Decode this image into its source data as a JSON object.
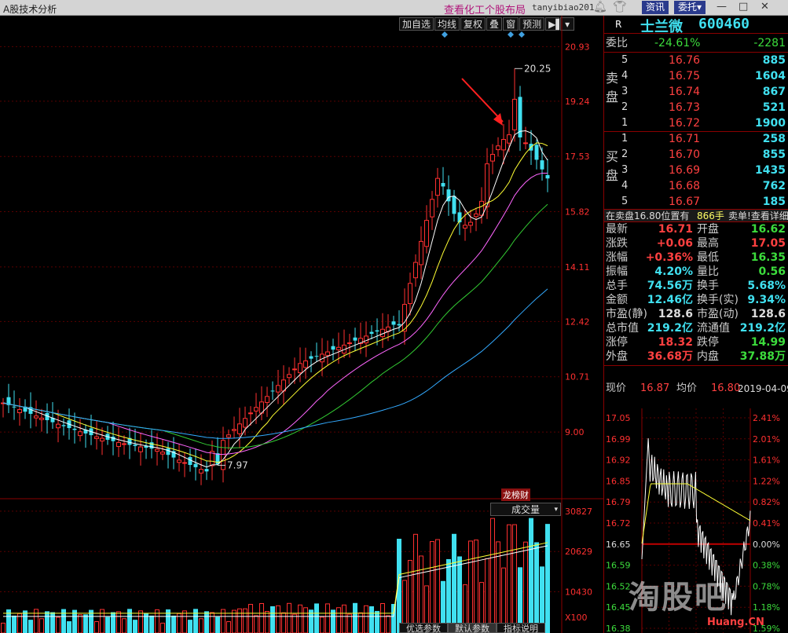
{
  "window": {
    "title": "A股技术分析",
    "promo_text": "查看化工个股布局",
    "account": "tanyibiao201",
    "news_button": "资讯",
    "order_button": "委托",
    "order_caret": "▾",
    "bell_icon": "bell-icon",
    "shirt_icon": "shirt-icon"
  },
  "chart_toolbar": {
    "items": [
      "加自选",
      "均线",
      "复权",
      "叠",
      "窗",
      "预测",
      "▶▌",
      "▾"
    ]
  },
  "stock": {
    "r_mark": "R",
    "name": "士兰微",
    "code": "600460"
  },
  "order_ratio": {
    "label": "委比",
    "percent": "-24.61%",
    "diff": "-2281"
  },
  "sell_side_label": [
    "卖",
    "盘"
  ],
  "buy_side_label": [
    "买",
    "盘"
  ],
  "asks": [
    {
      "level": "5",
      "price": "16.76",
      "volume": "885"
    },
    {
      "level": "4",
      "price": "16.75",
      "volume": "1604"
    },
    {
      "level": "3",
      "price": "16.74",
      "volume": "867"
    },
    {
      "level": "2",
      "price": "16.73",
      "volume": "521"
    },
    {
      "level": "1",
      "price": "16.72",
      "volume": "1900"
    }
  ],
  "bids": [
    {
      "level": "1",
      "price": "16.71",
      "volume": "258"
    },
    {
      "level": "2",
      "price": "16.70",
      "volume": "855"
    },
    {
      "level": "3",
      "price": "16.69",
      "volume": "1435"
    },
    {
      "level": "4",
      "price": "16.68",
      "volume": "762"
    },
    {
      "level": "5",
      "price": "16.67",
      "volume": "185"
    }
  ],
  "tape": {
    "text": "在卖盘16.80位置有",
    "volume": "866手",
    "link": "卖单!查看详细"
  },
  "quote": [
    {
      "l1": "最新",
      "v1": "16.71",
      "c1": "red",
      "l2": "开盘",
      "v2": "16.62",
      "c2": "green"
    },
    {
      "l1": "涨跌",
      "v1": "+0.06",
      "c1": "red",
      "l2": "最高",
      "v2": "17.05",
      "c2": "red"
    },
    {
      "l1": "涨幅",
      "v1": "+0.36%",
      "c1": "red",
      "l2": "最低",
      "v2": "16.35",
      "c2": "green"
    },
    {
      "l1": "振幅",
      "v1": "4.20%",
      "c1": "cyan",
      "l2": "量比",
      "v2": "0.56",
      "c2": "green"
    },
    {
      "l1": "总手",
      "v1": "74.56万",
      "c1": "cyan",
      "l2": "换手",
      "v2": "5.68%",
      "c2": "cyan"
    },
    {
      "l1": "金额",
      "v1": "12.46亿",
      "c1": "cyan",
      "l2": "换手(实)",
      "v2": "9.34%",
      "c2": "cyan"
    },
    {
      "l1": "市盈(静)",
      "v1": "128.6",
      "c1": "white",
      "l2": "市盈(动)",
      "v2": "128.6",
      "c2": "white"
    },
    {
      "l1": "总市值",
      "v1": "219.2亿",
      "c1": "cyan",
      "l2": "流通值",
      "v2": "219.2亿",
      "c2": "cyan"
    },
    {
      "l1": "涨停",
      "v1": "18.32",
      "c1": "red",
      "l2": "跌停",
      "v2": "14.99",
      "c2": "green"
    },
    {
      "l1": "外盘",
      "v1": "36.68万",
      "c1": "red",
      "l2": "内盘",
      "v2": "37.88万",
      "c2": "green"
    }
  ],
  "intraday": {
    "now_label": "现价",
    "now_value": "16.87",
    "avg_label": "均价",
    "avg_value": "16.80",
    "date": "2019-04-09",
    "price_ticks": [
      "17.05",
      "16.99",
      "16.92",
      "16.85",
      "16.79",
      "16.72",
      "16.65",
      "16.59",
      "16.52",
      "16.45",
      "16.38"
    ],
    "pct_ticks": [
      "2.41%",
      "2.01%",
      "1.61%",
      "1.22%",
      "0.82%",
      "0.41%",
      "0.00%",
      "0.38%",
      "0.78%",
      "1.18%",
      "1.59%"
    ]
  },
  "kline": {
    "price_ticks": [
      "20.93",
      "19.24",
      "17.53",
      "15.82",
      "14.11",
      "12.42",
      "10.71",
      "9.00"
    ],
    "high_label": "20.25",
    "low_label": "7.97",
    "volume_ticks": [
      "30827",
      "20629",
      "10430"
    ],
    "volume_unit": "X100",
    "dragon_tiger": "龙榜财",
    "indicator": "成交量",
    "dropdown_caret": "▾",
    "colors": {
      "up": "#ff3030",
      "down": "#40e0f0",
      "ma5": "#ffffff",
      "ma10": "#ffff33",
      "ma20": "#ff66ff",
      "ma30": "#33cc33",
      "ma60": "#33aaff"
    }
  },
  "bottom_tabs": [
    "优选参数",
    "默认参数",
    "指标说明"
  ],
  "watermark": {
    "text": "淘股吧",
    "site": "Huang.CN"
  }
}
